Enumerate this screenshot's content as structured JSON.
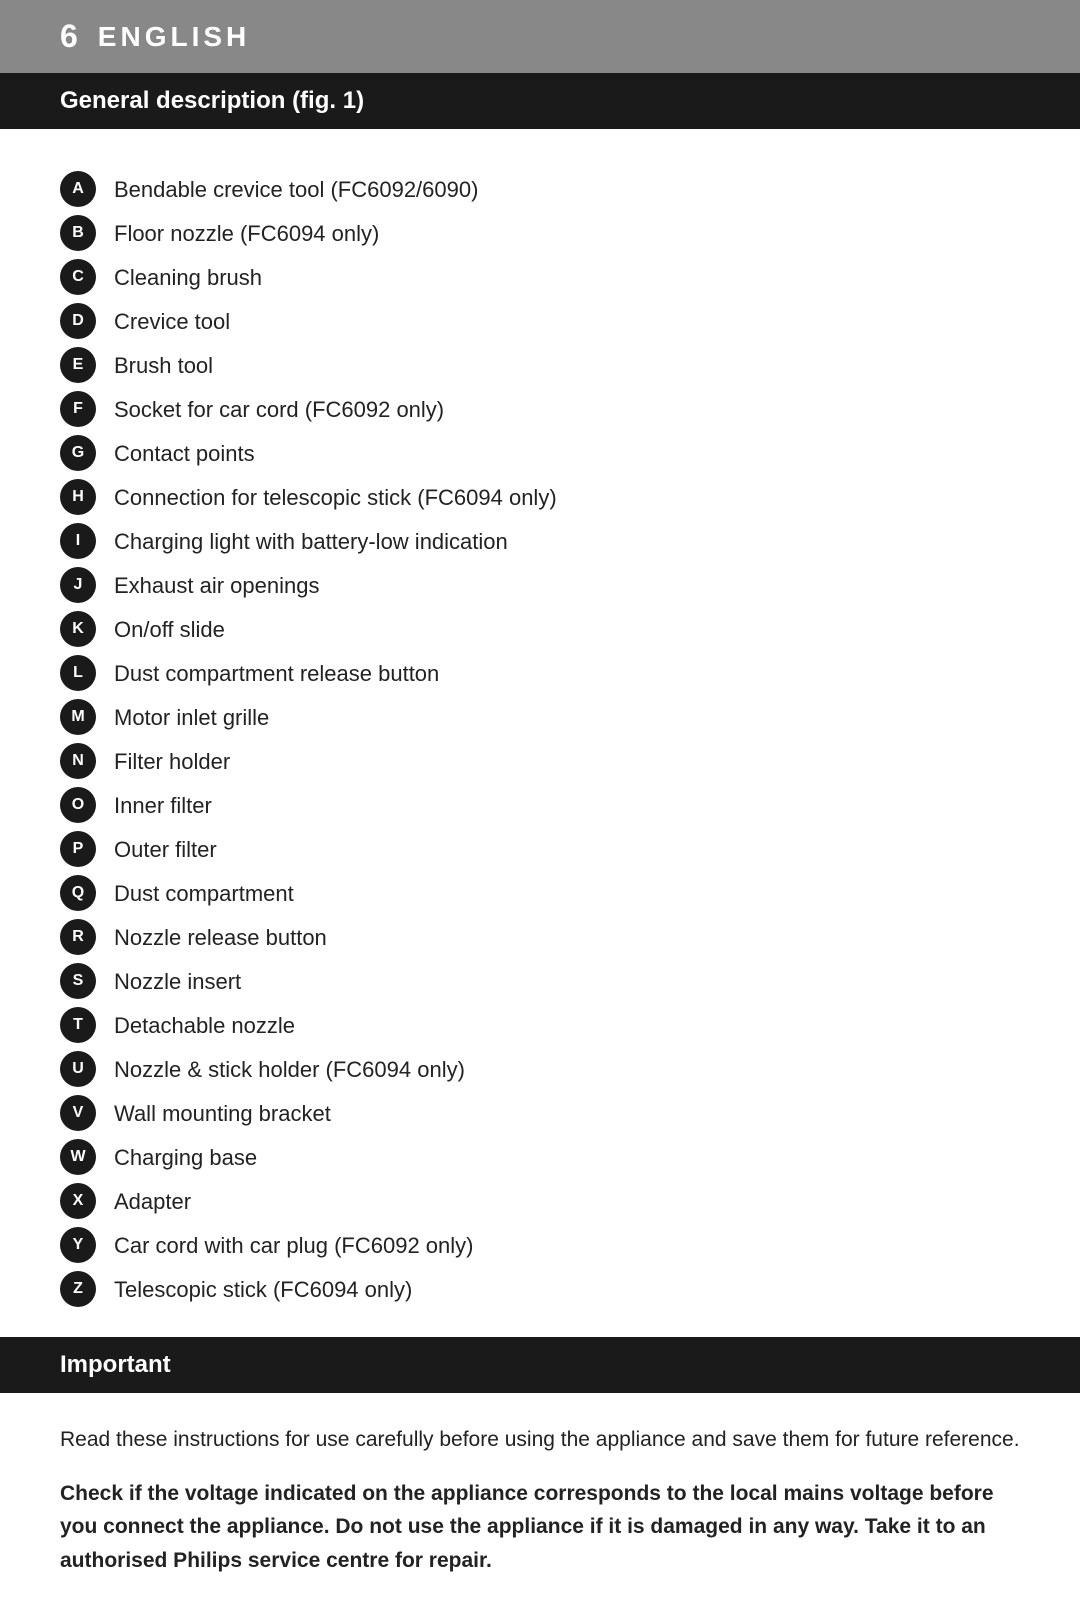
{
  "header": {
    "number": "6",
    "title": "ENGLISH"
  },
  "general_description": {
    "section_title": "General description (fig. 1)",
    "items": [
      {
        "letter": "A",
        "text": "Bendable crevice tool (FC6092/6090)"
      },
      {
        "letter": "B",
        "text": "Floor nozzle (FC6094 only)"
      },
      {
        "letter": "C",
        "text": "Cleaning brush"
      },
      {
        "letter": "D",
        "text": "Crevice tool"
      },
      {
        "letter": "E",
        "text": "Brush tool"
      },
      {
        "letter": "F",
        "text": "Socket for car cord (FC6092 only)"
      },
      {
        "letter": "G",
        "text": "Contact points"
      },
      {
        "letter": "H",
        "text": "Connection for telescopic stick (FC6094 only)"
      },
      {
        "letter": "I",
        "text": "Charging light with battery-low indication"
      },
      {
        "letter": "J",
        "text": "Exhaust air openings"
      },
      {
        "letter": "K",
        "text": "On/off slide"
      },
      {
        "letter": "L",
        "text": "Dust compartment release button"
      },
      {
        "letter": "M",
        "text": "Motor inlet grille"
      },
      {
        "letter": "N",
        "text": "Filter holder"
      },
      {
        "letter": "O",
        "text": "Inner filter"
      },
      {
        "letter": "P",
        "text": "Outer filter"
      },
      {
        "letter": "Q",
        "text": "Dust compartment"
      },
      {
        "letter": "R",
        "text": "Nozzle release button"
      },
      {
        "letter": "S",
        "text": "Nozzle insert"
      },
      {
        "letter": "T",
        "text": "Detachable nozzle"
      },
      {
        "letter": "U",
        "text": "Nozzle & stick holder (FC6094 only)"
      },
      {
        "letter": "V",
        "text": "Wall mounting bracket"
      },
      {
        "letter": "W",
        "text": "Charging base"
      },
      {
        "letter": "X",
        "text": "Adapter"
      },
      {
        "letter": "Y",
        "text": "Car cord with car plug (FC6092 only)"
      },
      {
        "letter": "Z",
        "text": "Telescopic stick (FC6094 only)"
      }
    ]
  },
  "important": {
    "section_title": "Important",
    "intro_text": "Read these instructions for use carefully before using the appliance and save them for future reference.",
    "warning_text": "Check if the voltage indicated on the appliance corresponds to the local mains voltage before you connect the appliance. Do not use the appliance if it is damaged in any way. Take it to an authorised Philips service centre for repair."
  }
}
